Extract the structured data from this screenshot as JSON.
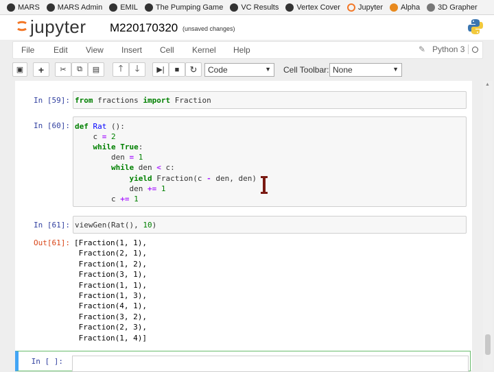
{
  "bookmarks": [
    {
      "label": "MARS",
      "icon": "github-icon"
    },
    {
      "label": "MARS Admin",
      "icon": "github-icon"
    },
    {
      "label": "EMIL",
      "icon": "github-icon"
    },
    {
      "label": "The Pumping Game",
      "icon": "github-icon"
    },
    {
      "label": "VC Results",
      "icon": "github-icon"
    },
    {
      "label": "Vertex Cover",
      "icon": "github-icon"
    },
    {
      "label": "Jupyter",
      "icon": "jupyter-icon"
    },
    {
      "label": "Alpha",
      "icon": "gear-icon"
    },
    {
      "label": "3D Grapher",
      "icon": "globe-icon"
    }
  ],
  "header": {
    "logo_text": "jupyter",
    "notebook_name": "M220170320",
    "save_status": "(unsaved changes)"
  },
  "menubar": {
    "items": [
      "File",
      "Edit",
      "View",
      "Insert",
      "Cell",
      "Kernel",
      "Help"
    ],
    "kernel_name": "Python 3"
  },
  "toolbar": {
    "cell_type": "Code",
    "cell_toolbar_label": "Cell Toolbar:",
    "cell_toolbar_value": "None"
  },
  "cells": {
    "c59": {
      "prompt": "In [59]:",
      "code": "from fractions import Fraction"
    },
    "c60": {
      "prompt": "In [60]:"
    },
    "c61": {
      "prompt": "In [61]:",
      "code": "viewGen(Rat(), 10)",
      "out_prompt": "Out[61]:",
      "output": [
        "[Fraction(1, 1),",
        " Fraction(2, 1),",
        " Fraction(1, 2),",
        " Fraction(3, 1),",
        " Fraction(1, 1),",
        " Fraction(1, 3),",
        " Fraction(4, 1),",
        " Fraction(3, 2),",
        " Fraction(2, 3),",
        " Fraction(1, 4)]"
      ]
    },
    "empty": {
      "prompt": "In [ ]:"
    }
  }
}
